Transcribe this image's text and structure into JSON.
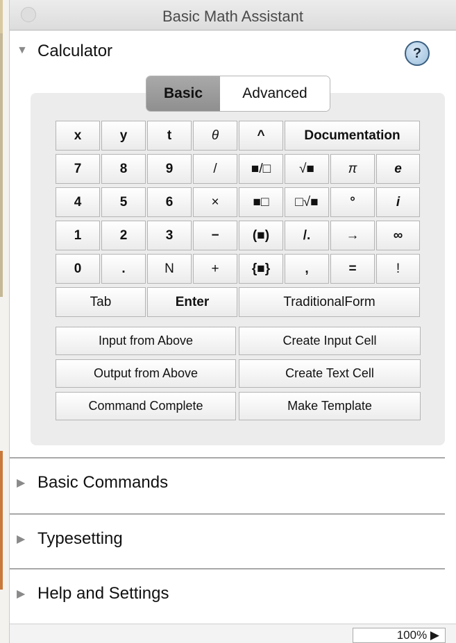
{
  "window": {
    "title": "Basic Math Assistant"
  },
  "sections": {
    "calculator": "Calculator",
    "basic_commands": "Basic Commands",
    "typesetting": "Typesetting",
    "help_settings": "Help and Settings"
  },
  "icons": {
    "expanded": "▼",
    "collapsed": "▶",
    "help": "?"
  },
  "tabs": {
    "basic": "Basic",
    "advanced": "Advanced",
    "selected": "Basic"
  },
  "keypad": [
    {
      "label": "x",
      "style": "b"
    },
    {
      "label": "y",
      "style": "b"
    },
    {
      "label": "t",
      "style": "b"
    },
    {
      "label": "θ",
      "style": "i"
    },
    {
      "label": "^",
      "style": "b"
    },
    {
      "label": "Documentation",
      "style": "b"
    },
    {
      "label": "7",
      "style": "b"
    },
    {
      "label": "8",
      "style": "b"
    },
    {
      "label": "9",
      "style": "b"
    },
    {
      "label": "/",
      "style": ""
    },
    {
      "label": "■/□",
      "style": ""
    },
    {
      "label": "√■",
      "style": ""
    },
    {
      "label": "π",
      "style": "i"
    },
    {
      "label": "e",
      "style": "b i"
    },
    {
      "label": "4",
      "style": "b"
    },
    {
      "label": "5",
      "style": "b"
    },
    {
      "label": "6",
      "style": "b"
    },
    {
      "label": "×",
      "style": ""
    },
    {
      "label": "■□",
      "style": ""
    },
    {
      "label": "□√■",
      "style": ""
    },
    {
      "label": "°",
      "style": "b"
    },
    {
      "label": "i",
      "style": "b i"
    },
    {
      "label": "1",
      "style": "b"
    },
    {
      "label": "2",
      "style": "b"
    },
    {
      "label": "3",
      "style": "b"
    },
    {
      "label": "−",
      "style": "b"
    },
    {
      "label": "(■)",
      "style": "b"
    },
    {
      "label": "/.",
      "style": "b"
    },
    {
      "label": "→",
      "style": "b"
    },
    {
      "label": "∞",
      "style": "b"
    },
    {
      "label": "0",
      "style": "b"
    },
    {
      "label": ".",
      "style": "b"
    },
    {
      "label": "N",
      "style": ""
    },
    {
      "label": "+",
      "style": ""
    },
    {
      "label": "{■}",
      "style": "b"
    },
    {
      "label": ",",
      "style": "b"
    },
    {
      "label": "=",
      "style": "b"
    },
    {
      "label": "!",
      "style": ""
    },
    {
      "label": "Tab",
      "style": ""
    },
    {
      "label": "Enter",
      "style": "b"
    },
    {
      "label": "TraditionalForm",
      "style": ""
    }
  ],
  "actions": [
    {
      "label": "Input from Above"
    },
    {
      "label": "Create Input Cell"
    },
    {
      "label": "Output from Above"
    },
    {
      "label": "Create Text Cell"
    },
    {
      "label": "Command Complete"
    },
    {
      "label": "Make Template"
    }
  ],
  "status": {
    "zoom": "100%",
    "zoom_arrow": "▶"
  },
  "colors": {
    "panel": "#ececec",
    "selected_tab": "#9a9a9a",
    "help_button": "#a9c7e1"
  }
}
